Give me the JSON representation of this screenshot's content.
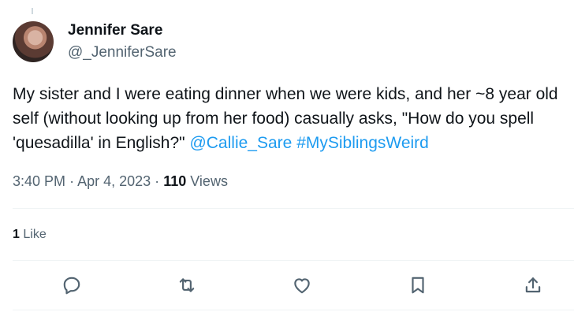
{
  "author": {
    "display_name": "Jennifer Sare",
    "handle": "@_JenniferSare"
  },
  "tweet": {
    "text_plain": "My sister and I were eating dinner when we were kids, and her ~8 year old self (without looking up from her food) casually asks, \"How do you spell 'quesadilla' in English?\" ",
    "mention": "@Callie_Sare",
    "hashtag": "#MySiblingsWeird"
  },
  "meta": {
    "time": "3:40 PM",
    "separator": "·",
    "date": "Apr 4, 2023",
    "views_count": "110",
    "views_label": "Views"
  },
  "engagement": {
    "likes_count": "1",
    "likes_label": "Like"
  },
  "colors": {
    "link": "#1d9bf0",
    "secondary_text": "#536471",
    "primary_text": "#0f1419",
    "divider": "#eff3f4"
  },
  "actions": [
    {
      "icon": "reply-icon"
    },
    {
      "icon": "retweet-icon"
    },
    {
      "icon": "like-icon"
    },
    {
      "icon": "bookmark-icon"
    },
    {
      "icon": "share-icon"
    }
  ]
}
